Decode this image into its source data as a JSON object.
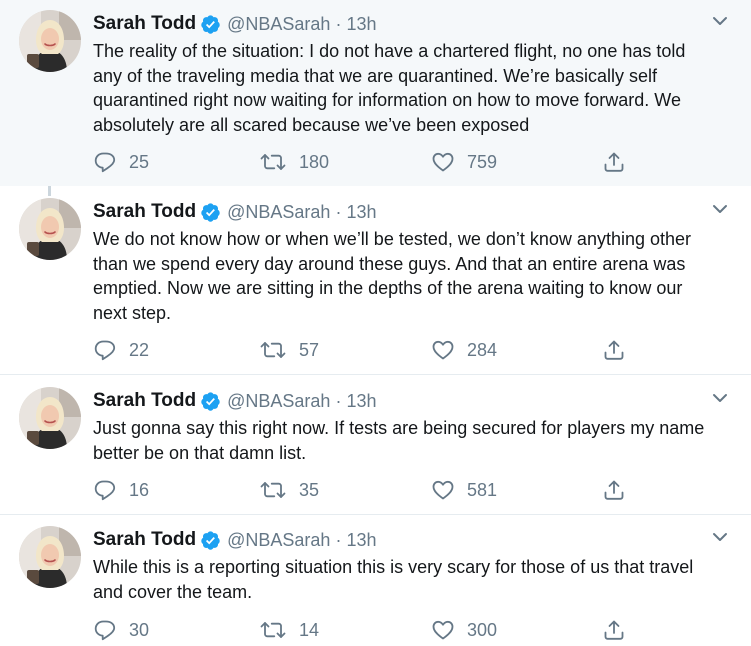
{
  "tweets": [
    {
      "name": "Sarah Todd",
      "handle": "@NBASarah",
      "separator": "·",
      "time": "13h",
      "lines": [
        "The reality of the situation: I do not have a chartered flight, no one has told",
        "any of the traveling media that we are quarantined. We’re basically self",
        "quarantined right now waiting for information on how to move forward. We",
        "absolutely are all scared because we’ve been exposed"
      ],
      "replies": "25",
      "retweets": "180",
      "likes": "759"
    },
    {
      "name": "Sarah Todd",
      "handle": "@NBASarah",
      "separator": "·",
      "time": "13h",
      "lines": [
        "We do not know how or when we’ll be tested, we don’t know anything other",
        "than we spend every day around these guys. And that an entire arena was",
        "emptied. Now we are sitting in the depths of the arena waiting to know our",
        "next step."
      ],
      "replies": "22",
      "retweets": "57",
      "likes": "284"
    },
    {
      "name": "Sarah Todd",
      "handle": "@NBASarah",
      "separator": "·",
      "time": "13h",
      "lines": [
        "Just gonna say this right now. If tests are being secured for players my name",
        "better be on that damn list."
      ],
      "replies": "16",
      "retweets": "35",
      "likes": "581"
    },
    {
      "name": "Sarah Todd",
      "handle": "@NBASarah",
      "separator": "·",
      "time": "13h",
      "lines": [
        "While this is a reporting situation this is very scary for those of us that travel",
        "and cover the team."
      ],
      "replies": "30",
      "retweets": "14",
      "likes": "300"
    }
  ],
  "icons": {
    "verified": "verified-badge-icon",
    "caret": "chevron-down-icon",
    "reply": "reply-icon",
    "retweet": "retweet-icon",
    "like": "heart-icon",
    "share": "share-icon"
  },
  "colors": {
    "text": "#14171a",
    "secondary": "#657786",
    "verified": "#1da1f2",
    "highlight_bg": "#f5f8fa",
    "thread_line": "#ccd6dd",
    "divider": "#e6ecf0"
  }
}
